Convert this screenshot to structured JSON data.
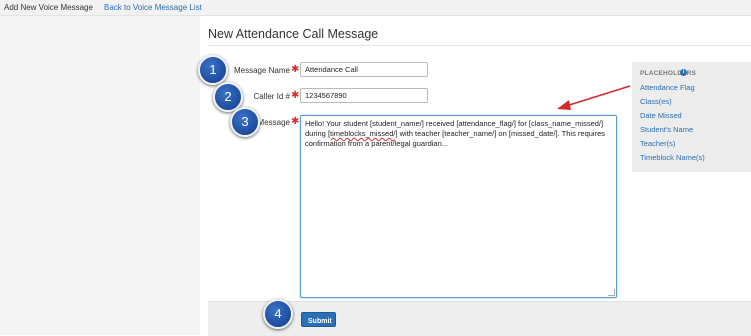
{
  "topbar": {
    "current": "Add New Voice Message",
    "back_link": "Back to Voice Message List"
  },
  "page": {
    "title": "New Attendance Call Message"
  },
  "form": {
    "required_marker": "✱",
    "message_name": {
      "label": "Message Name",
      "value": "Attendance Call"
    },
    "caller_id": {
      "label": "Caller Id #",
      "value": "1234567890"
    },
    "message": {
      "label": "Message",
      "value_parts": [
        "Hello! Your student [student_name/] received [attendance_flag/] for [class_name_missed/] during ",
        "[timeblocks_missed/]",
        " with teacher [teacher_name/] on [missed_date/]. This requires confirmation from a parent/legal guardian..."
      ]
    },
    "submit_label": "Submit"
  },
  "placeholders": {
    "title": "PLACEHOLDERS",
    "info_glyph": "i",
    "items": [
      "Attendance Flag",
      "Class(es)",
      "Date Missed",
      "Student's Name",
      "Teacher(s)",
      "Timeblock Name(s)"
    ]
  },
  "callouts": [
    "1",
    "2",
    "3",
    "4"
  ],
  "colors": {
    "accent": "#2a6fb0",
    "required": "#d9302c",
    "badge": "#1c4c9c",
    "arrow": "#d42a2a"
  }
}
